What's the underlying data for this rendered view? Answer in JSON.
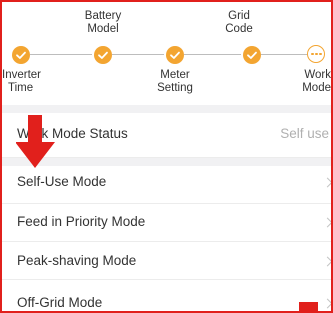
{
  "steps": {
    "top_labels": {
      "battery_model_1": "Battery",
      "battery_model_2": "Model",
      "grid_code_1": "Grid",
      "grid_code_2": "Code"
    },
    "bottom_labels": {
      "inverter_time_1": "Inverter",
      "inverter_time_2": "Time",
      "meter_setting_1": "Meter",
      "meter_setting_2": "Setting",
      "work_mode_1": "Work",
      "work_mode_2": "Mode"
    },
    "accent_color": "#f3a531"
  },
  "status": {
    "label": "Work Mode Status",
    "value": "Self use"
  },
  "modes": [
    {
      "label": "Self-Use Mode"
    },
    {
      "label": "Feed in Priority Mode"
    },
    {
      "label": "Peak-shaving Mode"
    },
    {
      "label": "Off-Grid Mode"
    }
  ],
  "annotation_color": "#e1201c"
}
